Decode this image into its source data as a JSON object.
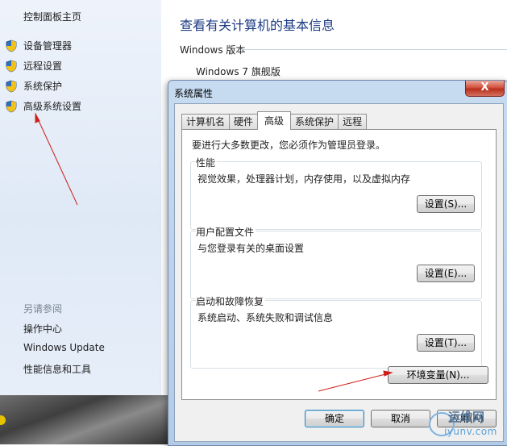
{
  "left_nav": {
    "home": "控制面板主页",
    "links": [
      {
        "label": "设备管理器",
        "icon": "uac-shield-icon"
      },
      {
        "label": "远程设置",
        "icon": "uac-shield-icon"
      },
      {
        "label": "系统保护",
        "icon": "uac-shield-icon"
      },
      {
        "label": "高级系统设置",
        "icon": "uac-shield-icon"
      }
    ],
    "see_also": "另请参阅",
    "see_also_links": [
      "操作中心",
      "Windows Update",
      "性能信息和工具"
    ]
  },
  "main": {
    "title": "查看有关计算机的基本信息",
    "section": "Windows 版本",
    "edition": "Windows 7 旗舰版"
  },
  "dialog": {
    "title": "系统属性",
    "close": "X",
    "tabs": [
      "计算机名",
      "硬件",
      "高级",
      "系统保护",
      "远程"
    ],
    "active_tab": "高级",
    "admin_note": "要进行大多数更改，您必须作为管理员登录。",
    "groups": [
      {
        "title": "性能",
        "desc": "视觉效果，处理器计划，内存使用，以及虚拟内存",
        "button": "设置(S)..."
      },
      {
        "title": "用户配置文件",
        "desc": "与您登录有关的桌面设置",
        "button": "设置(E)..."
      },
      {
        "title": "启动和故障恢复",
        "desc": "系统启动、系统失败和调试信息",
        "button": "设置(T)..."
      }
    ],
    "env_button": "环境变量(N)...",
    "ok": "确定",
    "cancel": "取消",
    "apply": "应用(A)"
  },
  "watermark": {
    "line1": "运维网",
    "line2": "iyunv.com"
  },
  "colors": {
    "title_blue": "#1c3b84",
    "annotation_red": "#d0201a"
  }
}
